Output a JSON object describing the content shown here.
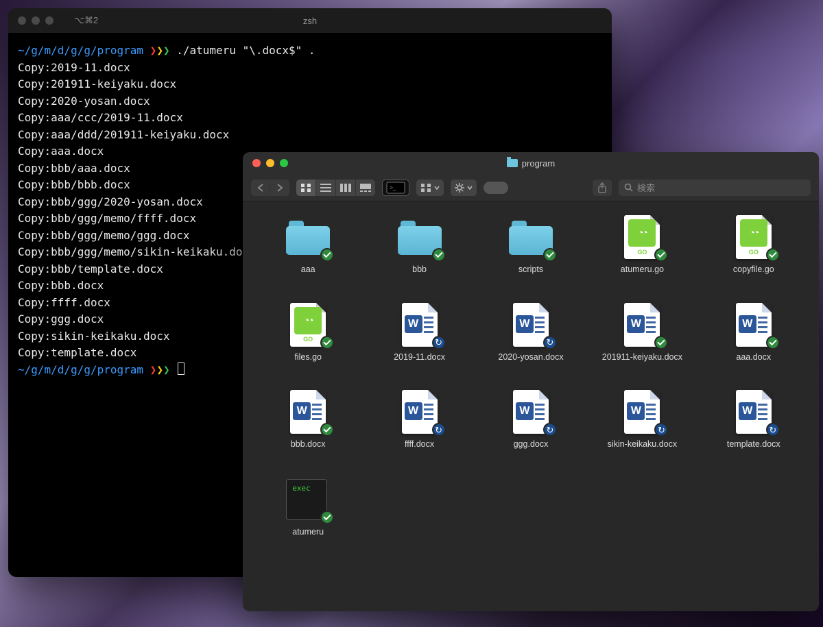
{
  "terminal": {
    "tab_hint": "⌥⌘2",
    "shell_name": "zsh",
    "prompt_path": "~/g/m/d/g/g/program",
    "prompt_arrows": "❯❯❯",
    "command": "./atumeru \"\\.docx$\" .",
    "output_lines": [
      "Copy:2019-11.docx",
      "Copy:201911-keiyaku.docx",
      "Copy:2020-yosan.docx",
      "Copy:aaa/ccc/2019-11.docx",
      "Copy:aaa/ddd/201911-keiyaku.docx",
      "Copy:aaa.docx",
      "Copy:bbb/aaa.docx",
      "Copy:bbb/bbb.docx",
      "Copy:bbb/ggg/2020-yosan.docx",
      "Copy:bbb/ggg/memo/ffff.docx",
      "Copy:bbb/ggg/memo/ggg.docx",
      "Copy:bbb/ggg/memo/sikin-keikaku.do",
      "Copy:bbb/template.docx",
      "Copy:bbb.docx",
      "Copy:ffff.docx",
      "Copy:ggg.docx",
      "Copy:sikin-keikaku.docx",
      "Copy:template.docx"
    ]
  },
  "finder": {
    "title": "program",
    "search_placeholder": "検索",
    "go_label": "GO",
    "exec_label": "exec",
    "items": [
      {
        "name": "aaa",
        "type": "folder",
        "badge": "check"
      },
      {
        "name": "bbb",
        "type": "folder",
        "badge": "check"
      },
      {
        "name": "scripts",
        "type": "folder",
        "badge": "check"
      },
      {
        "name": "atumeru.go",
        "type": "go",
        "badge": "check"
      },
      {
        "name": "copyfile.go",
        "type": "go",
        "badge": "check"
      },
      {
        "name": "files.go",
        "type": "go",
        "badge": "check"
      },
      {
        "name": "2019-11.docx",
        "type": "docx",
        "badge": "sync"
      },
      {
        "name": "2020-yosan.docx",
        "type": "docx",
        "badge": "sync"
      },
      {
        "name": "201911-keiyaku.docx",
        "type": "docx",
        "badge": "check"
      },
      {
        "name": "aaa.docx",
        "type": "docx",
        "badge": "check"
      },
      {
        "name": "bbb.docx",
        "type": "docx",
        "badge": "check"
      },
      {
        "name": "ffff.docx",
        "type": "docx",
        "badge": "sync"
      },
      {
        "name": "ggg.docx",
        "type": "docx",
        "badge": "sync"
      },
      {
        "name": "sikin-keikaku.docx",
        "type": "docx",
        "badge": "sync"
      },
      {
        "name": "template.docx",
        "type": "docx",
        "badge": "sync"
      },
      {
        "name": "atumeru",
        "type": "exec",
        "badge": "check"
      }
    ]
  }
}
